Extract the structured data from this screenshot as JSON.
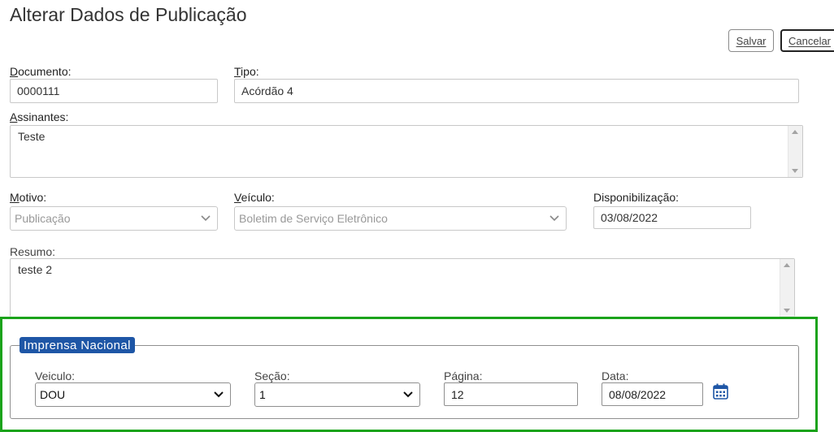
{
  "page": {
    "title": "Alterar Dados de Publicação"
  },
  "toolbar": {
    "save_label_accel": "S",
    "save_label_rest": "alvar",
    "cancel_label_accel": "C",
    "cancel_label_rest": "ancelar"
  },
  "form": {
    "documento": {
      "label_accel": "D",
      "label_rest": "ocumento:",
      "value": "0000111"
    },
    "tipo": {
      "label_accel": "T",
      "label_rest": "ipo:",
      "value": "Acórdão 4"
    },
    "assinantes": {
      "label_accel": "A",
      "label_rest": "ssinantes:",
      "value": "Teste"
    },
    "motivo": {
      "label_accel": "M",
      "label_rest": "otivo:",
      "selected": "Publicação"
    },
    "veiculo": {
      "label_accel": "V",
      "label_rest": "eículo:",
      "selected": "Boletim de Serviço Eletrônico"
    },
    "disponibilizacao": {
      "label": "Disponibilização:",
      "value": "03/08/2022"
    },
    "resumo": {
      "label": "Resumo:",
      "value": "teste 2"
    }
  },
  "imprensa": {
    "legend": "Imprensa Nacional",
    "veiculo": {
      "label": "Veiculo:",
      "selected": "DOU"
    },
    "secao": {
      "label": "Seção:",
      "selected": "1"
    },
    "pagina": {
      "label": "Página:",
      "value": "12"
    },
    "data": {
      "label": "Data:",
      "value": "08/08/2022"
    }
  },
  "icons": {
    "calendar": "calendar-icon",
    "dropdown": "chevron-down-icon"
  },
  "colors": {
    "legend_bg": "#1e56a6",
    "highlight_border": "#1ba31b",
    "calendar_icon": "#1e56a6"
  }
}
